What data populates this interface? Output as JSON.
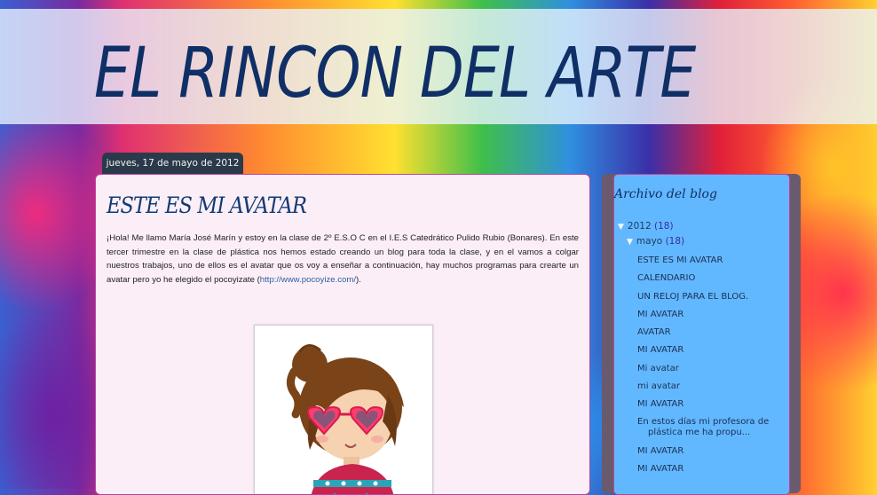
{
  "header": {
    "title": "EL RINCON DEL ARTE"
  },
  "post": {
    "date": "jueves, 17 de mayo de 2012",
    "title": "ESTE ES MI AVATAR",
    "body_text": "¡Hola! Me llamo María José Marín y estoy en la clase de 2º E.S.O C en el I.E.S Catedrático Pulido Rubio (Bonares). En este tercer trimestre en la clase de plástica nos hemos estado creando un blog para toda la clase, y en el vamos a colgar nuestros trabajos, uno de ellos es el avatar que os voy a enseñar a continuación, hay muchos programas para crearte un avatar pero yo he elegido el pocoyizate (",
    "link": "http://www.pocoyize.com/",
    "body_end": ")."
  },
  "sidebar": {
    "widget_title": "Archivo del blog",
    "year": "2012",
    "year_count": "(18)",
    "month": "mayo",
    "month_count": "(18)",
    "posts": [
      "ESTE ES MI AVATAR",
      "CALENDARIO",
      "UN RELOJ PARA EL BLOG.",
      "MI AVATAR",
      "AVATAR",
      "MI AVATAR",
      "Mi avatar",
      "mi avatar",
      "MI AVATAR",
      "En estos días mi profesora de plástica me ha propu...",
      "MI AVATAR",
      "MI AVATAR"
    ]
  },
  "colors": {
    "title": "#0f2f66",
    "post_bg": "#fbeef7",
    "sidebar_bg": "#62b8ff",
    "border_accent": "#c040a0"
  }
}
